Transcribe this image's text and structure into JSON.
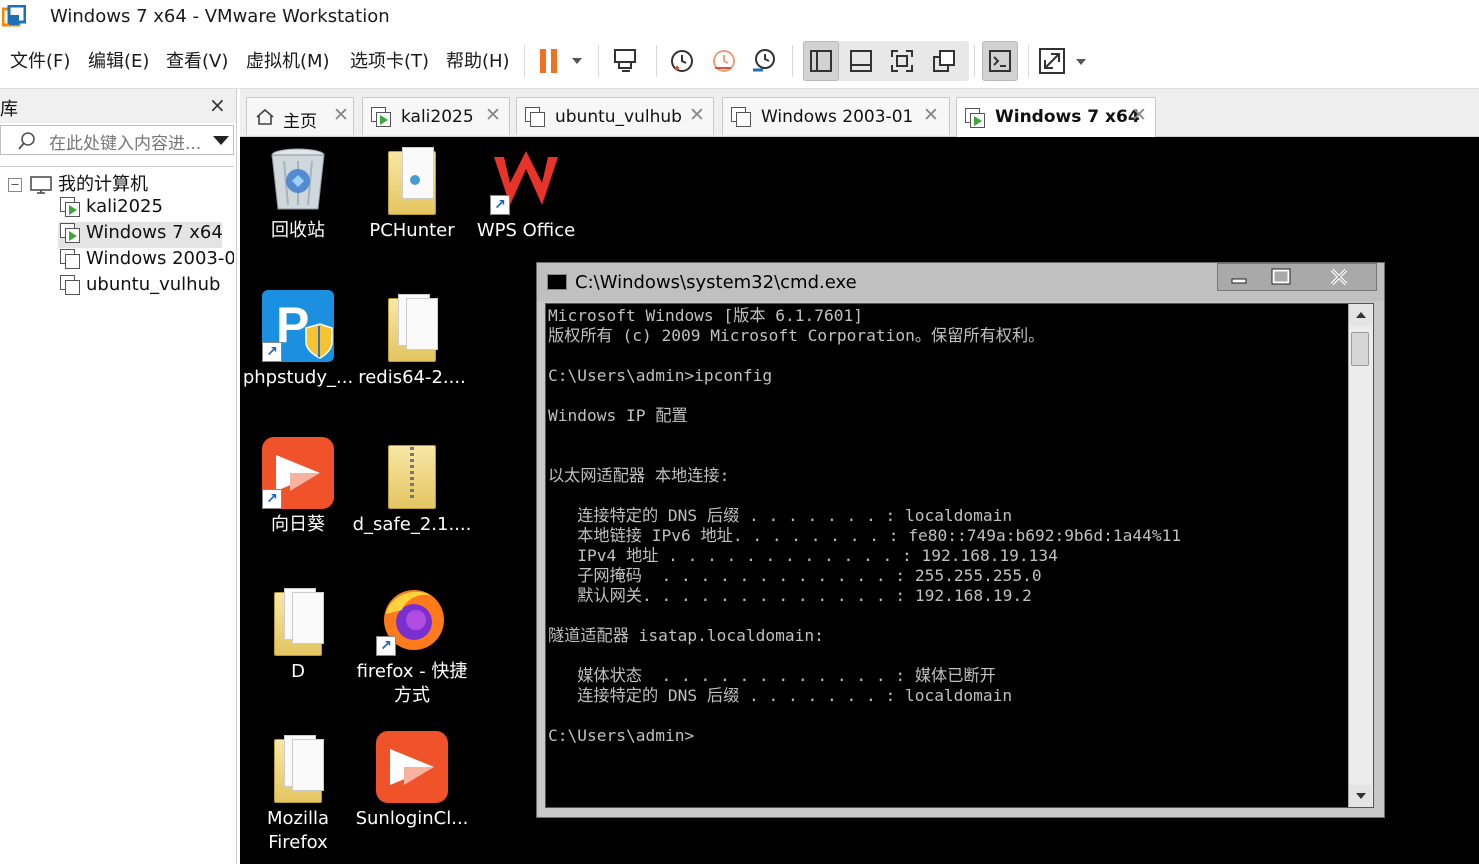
{
  "window": {
    "title": "Windows 7 x64 - VMware Workstation",
    "brand_color": "#f38b00"
  },
  "menu": [
    "文件(F)",
    "编辑(E)",
    "查看(V)",
    "虚拟机(M)",
    "选项卡(T)",
    "帮助(H)"
  ],
  "toolbar": {
    "pause_color": "#f37021",
    "icons": [
      "pause-icon",
      "send-ctrl-alt-del-icon",
      "snapshot-take-icon",
      "snapshot-revert-icon",
      "snapshot-manager-icon",
      "library-view-icon",
      "thumbnail-view-icon",
      "fullscreen-icon",
      "unity-icon",
      "console-view-icon",
      "stretch-icon"
    ]
  },
  "library": {
    "title": "库",
    "close": "×",
    "search_placeholder": "在此处键入内容进...",
    "tree": {
      "root": "我的计算机",
      "items": [
        "kali2025",
        "Windows 7 x64",
        "Windows  2003-0",
        "ubuntu_vulhub"
      ],
      "selected": "Windows 7 x64"
    }
  },
  "tabs": [
    {
      "label": "主页",
      "active": false
    },
    {
      "label": "kali2025",
      "active": false
    },
    {
      "label": "ubuntu_vulhub",
      "active": false
    },
    {
      "label": "Windows  2003-01",
      "active": false
    },
    {
      "label": "Windows 7 x64",
      "active": true
    }
  ],
  "desktop": {
    "icons": [
      {
        "label": "回收站",
        "icon": "recycle-bin-icon"
      },
      {
        "label": "PCHunter",
        "icon": "folder-icon"
      },
      {
        "label": "WPS Office",
        "icon": "wps-icon"
      },
      {
        "label": "phpstudy_...",
        "icon": "phpstudy-icon"
      },
      {
        "label": "redis64-2....",
        "icon": "folder-icon"
      },
      {
        "label": "向日葵",
        "icon": "sunlogin-icon"
      },
      {
        "label": "d_safe_2.1....",
        "icon": "zip-folder-icon"
      },
      {
        "label": "D",
        "icon": "folder-icon"
      },
      {
        "label": "firefox - 快捷",
        "label2": "方式",
        "icon": "firefox-icon"
      },
      {
        "label": "Mozilla",
        "label2": "Firefox",
        "icon": "folder-icon"
      },
      {
        "label": "SunloginCl...",
        "icon": "sunlogin-icon"
      }
    ]
  },
  "cmd": {
    "title": "C:\\Windows\\system32\\cmd.exe",
    "minimize": "–",
    "close": "✕",
    "output": "Microsoft Windows [版本 6.1.7601]\n版权所有 (c) 2009 Microsoft Corporation。保留所有权利。\n\nC:\\Users\\admin>ipconfig\n\nWindows IP 配置\n\n\n以太网适配器 本地连接:\n\n   连接特定的 DNS 后缀 . . . . . . . : localdomain\n   本地链接 IPv6 地址. . . . . . . . : fe80::749a:b692:9b6d:1a44%11\n   IPv4 地址 . . . . . . . . . . . . : 192.168.19.134\n   子网掩码  . . . . . . . . . . . . : 255.255.255.0\n   默认网关. . . . . . . . . . . . . : 192.168.19.2\n\n隧道适配器 isatap.localdomain:\n\n   媒体状态  . . . . . . . . . . . . : 媒体已断开\n   连接特定的 DNS 后缀 . . . . . . . : localdomain\n\nC:\\Users\\admin>"
  }
}
